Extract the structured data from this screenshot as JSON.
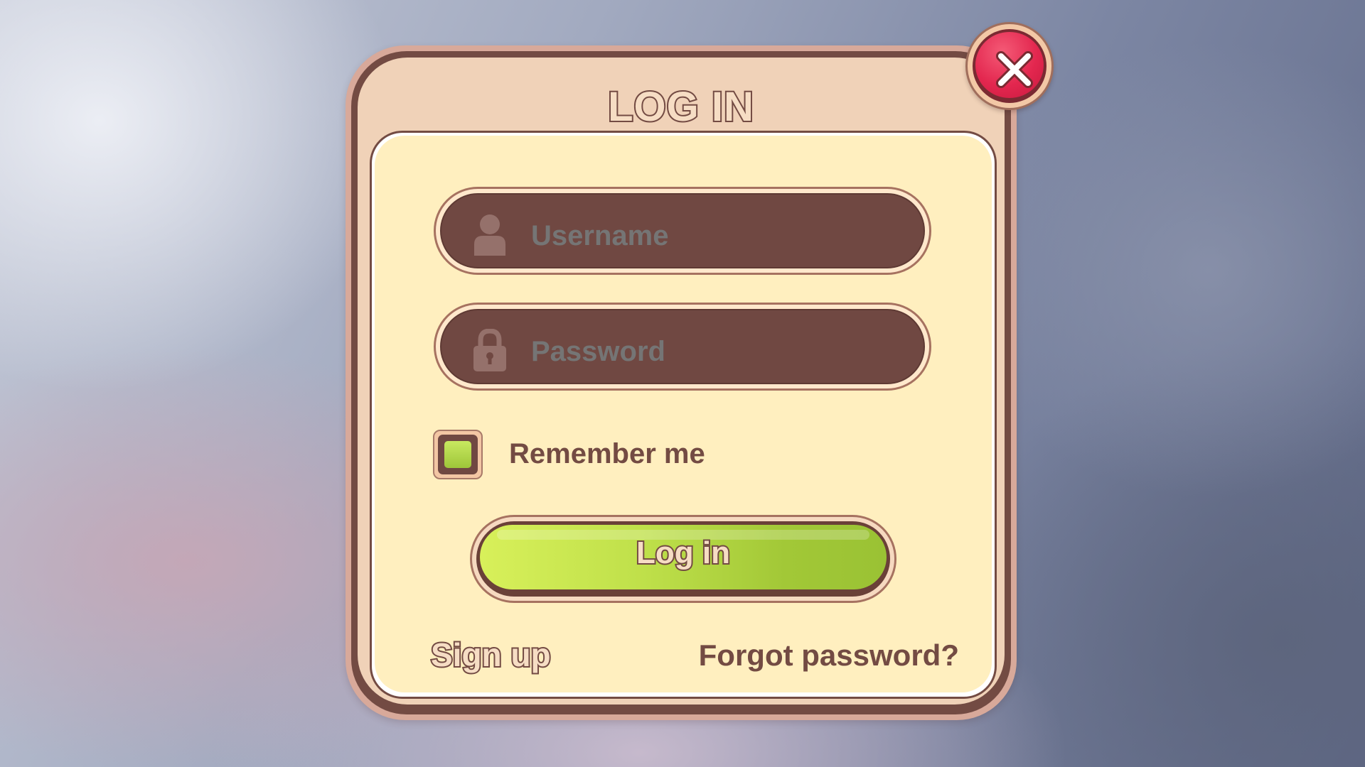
{
  "dialog": {
    "title": "LOG IN",
    "close_icon": "close-icon"
  },
  "username": {
    "placeholder": "Username",
    "icon": "user-icon"
  },
  "password": {
    "placeholder": "Password",
    "icon": "lock-icon"
  },
  "remember": {
    "label": "Remember me",
    "checked": true
  },
  "login_button": {
    "label": "Log in"
  },
  "links": {
    "sign_up": "Sign up",
    "forgot_password": "Forgot password?"
  },
  "colors": {
    "panel_frame": "#734b43",
    "panel_header": "#f0d2b8",
    "panel_body": "#ffefbf",
    "input_fill": "#704842",
    "placeholder_text": "#95716b",
    "button_green_light": "#d8f05a",
    "button_green_dark": "#9ac234",
    "close_red": "#e3274f",
    "text_brown": "#734b43"
  }
}
